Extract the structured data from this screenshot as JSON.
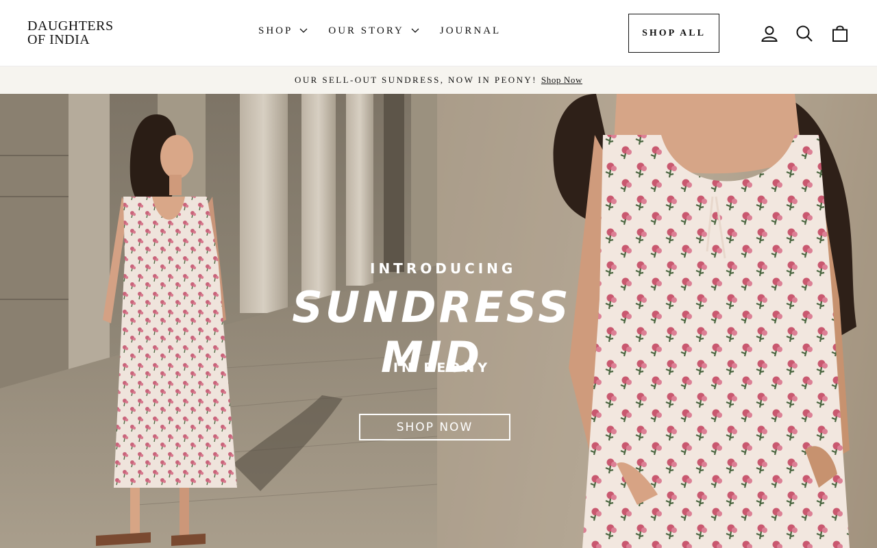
{
  "brand": {
    "line1": "DAUGHTERS",
    "line2": "OF INDIA"
  },
  "nav": {
    "items": [
      {
        "label": "SHOP",
        "has_dropdown": true
      },
      {
        "label": "OUR STORY",
        "has_dropdown": true
      },
      {
        "label": "JOURNAL",
        "has_dropdown": false
      }
    ]
  },
  "header": {
    "shop_all_label": "SHOP ALL",
    "icons": [
      "account-icon",
      "search-icon",
      "cart-icon"
    ]
  },
  "announcement": {
    "text": "OUR SELL-OUT SUNDRESS, NOW IN PEONY!",
    "link_label": "Shop Now"
  },
  "hero": {
    "eyebrow": "INTRODUCING",
    "headline": "SUNDRESS MID",
    "subhead": "IN PEONY",
    "cta_label": "SHOP NOW"
  },
  "colors": {
    "text": "#111111",
    "announcement_bg": "#f6f4ef",
    "hero_overlay_text": "#ffffff"
  }
}
